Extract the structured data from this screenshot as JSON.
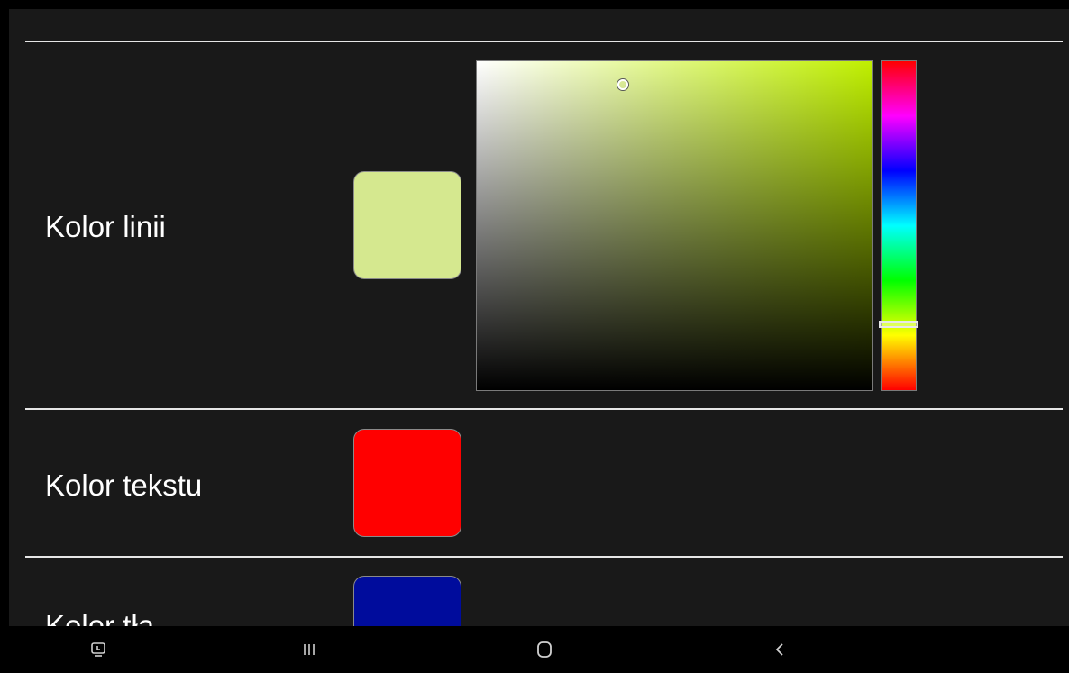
{
  "rows": [
    {
      "label": "Kolor linii",
      "color": "#d5e88f"
    },
    {
      "label": "Kolor tekstu",
      "color": "#ff0000"
    },
    {
      "label": "Kolor tła",
      "color": "#000c9c"
    }
  ],
  "picker": {
    "hue_color": "#c0f000",
    "saturation": 0.37,
    "value": 0.93,
    "hue_position_from_bottom": 0.2
  },
  "navbar": {
    "icons": [
      "recent-screenshot-icon",
      "recent-apps-icon",
      "home-icon",
      "back-icon"
    ]
  },
  "colors": {
    "background": "#191919",
    "divider": "#e6e6e6",
    "text": "#ffffff"
  }
}
